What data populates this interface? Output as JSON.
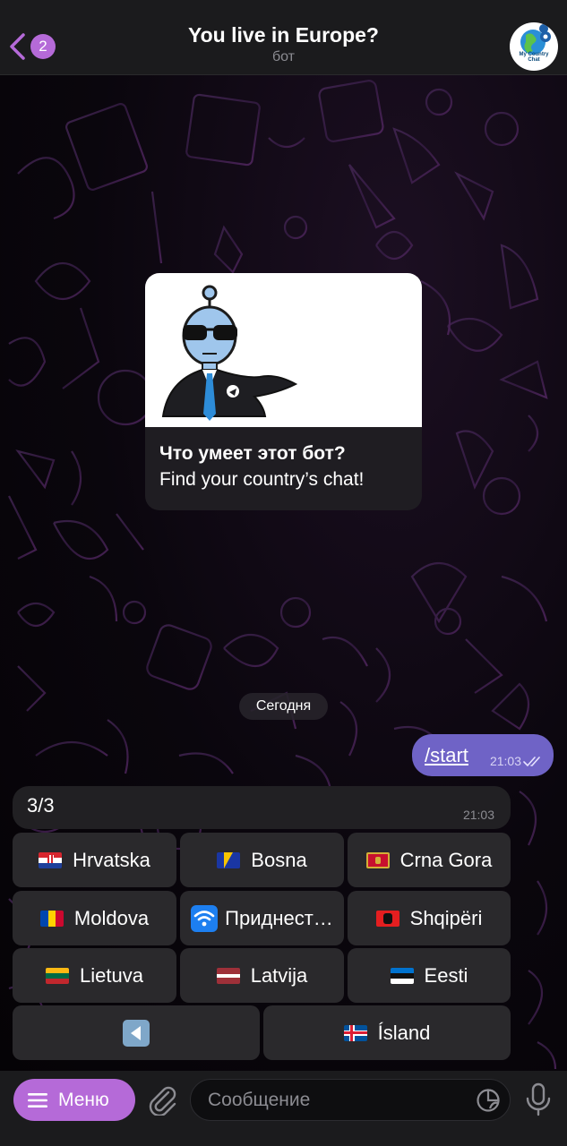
{
  "header": {
    "back_badge": "2",
    "title": "You live in Europe?",
    "subtitle": "бот",
    "avatar_text_line1": "My Country",
    "avatar_text_line2": "Chat"
  },
  "intro_card": {
    "title": "Что умеет этот бот?",
    "description": "Find your country’s chat!"
  },
  "date_separator": "Сегодня",
  "outgoing_message": {
    "text": "/start",
    "time": "21:03"
  },
  "incoming_message": {
    "text": "3/3",
    "time": "21:03"
  },
  "keyboard": {
    "rows": [
      [
        {
          "label": "Hrvatska",
          "flag": "croatia-flag"
        },
        {
          "label": "Bosna",
          "flag": "bosnia-flag"
        },
        {
          "label": "Crna Gora",
          "flag": "montenegro-flag"
        }
      ],
      [
        {
          "label": "Moldova",
          "flag": "moldova-flag"
        },
        {
          "label": "Приднест…",
          "flag": "wifi-icon"
        },
        {
          "label": "Shqipëri",
          "flag": "albania-flag"
        }
      ],
      [
        {
          "label": "Lietuva",
          "flag": "lithuania-flag"
        },
        {
          "label": "Latvija",
          "flag": "latvia-flag"
        },
        {
          "label": "Eesti",
          "flag": "estonia-flag"
        }
      ],
      [
        {
          "label": "",
          "flag": "back-arrow-icon"
        },
        {
          "label": "Ísland",
          "flag": "iceland-flag"
        }
      ]
    ]
  },
  "bottom_bar": {
    "menu_label": "Меню",
    "input_placeholder": "Сообщение"
  },
  "colors": {
    "accent": "#b56ad8",
    "outgoing_bubble": "#6f63c6",
    "button_bg": "#2a292c"
  }
}
